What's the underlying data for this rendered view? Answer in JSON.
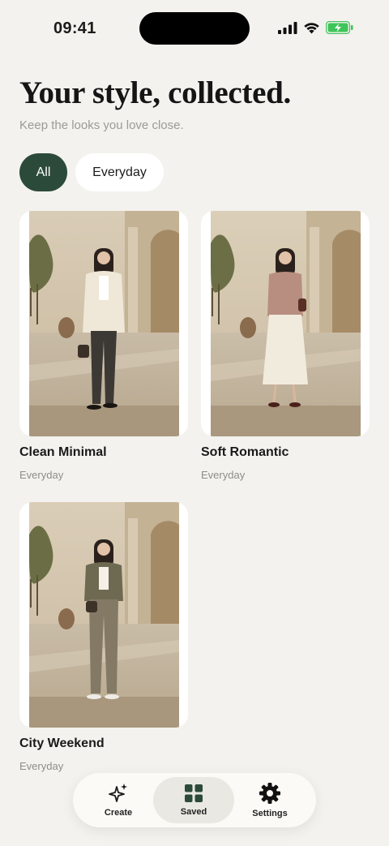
{
  "status_bar": {
    "time": "09:41"
  },
  "header": {
    "title": "Your style, collected.",
    "subtitle": "Keep the looks you love close."
  },
  "filters": [
    {
      "label": "All",
      "selected": true
    },
    {
      "label": "Everyday",
      "selected": false
    }
  ],
  "looks": [
    {
      "title": "Clean Minimal",
      "tag": "Everyday"
    },
    {
      "title": "Soft Romantic",
      "tag": "Everyday"
    },
    {
      "title": "City Weekend",
      "tag": "Everyday"
    }
  ],
  "bottom_nav": {
    "items": [
      {
        "label": "Create",
        "icon": "sparkle-icon",
        "active": false
      },
      {
        "label": "Saved",
        "icon": "grid-icon",
        "active": true
      },
      {
        "label": "Settings",
        "icon": "gear-icon",
        "active": false
      }
    ]
  },
  "colors": {
    "background": "#f3f2ee",
    "accent": "#2c4a39",
    "battery": "#3fc45a"
  }
}
